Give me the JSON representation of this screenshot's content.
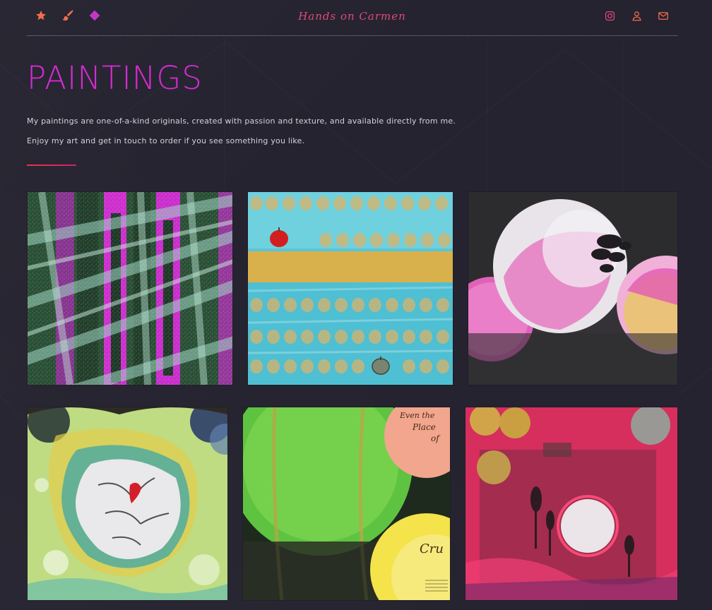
{
  "header": {
    "brand": "Hands on Carmen",
    "left_icons": [
      {
        "name": "star-icon",
        "color": "#f26d4f"
      },
      {
        "name": "paintbrush-icon",
        "color": "#f26d4f"
      },
      {
        "name": "diamond-icon",
        "color": "#c238c6"
      }
    ],
    "right_icons": [
      {
        "name": "instagram-icon",
        "color": "#e0497b"
      },
      {
        "name": "user-icon",
        "color": "#f26d4f"
      },
      {
        "name": "mail-icon",
        "color": "#f26d4f"
      }
    ]
  },
  "main": {
    "title": "PAINTINGS",
    "intro_line_1": "My paintings are one-of-a-kind originals, created with passion and texture, and available directly from me.",
    "intro_line_2": "Enjoy my art and get in touch to order if you see something you like."
  },
  "colors": {
    "background": "#25232f",
    "title": "#d52bd2",
    "accent_red": "#e3383f",
    "accent_pink": "#d31c7a"
  },
  "gallery": {
    "paintings": [
      {
        "id": "painting-1",
        "description_icon": "plaid-abstract"
      },
      {
        "id": "painting-2",
        "description_icon": "turquoise-gold-apples"
      },
      {
        "id": "painting-3",
        "description_icon": "pink-circles"
      },
      {
        "id": "painting-4",
        "description_icon": "shell-heart"
      },
      {
        "id": "painting-5",
        "description_icon": "green-yellow-circles"
      },
      {
        "id": "painting-6",
        "description_icon": "red-moon"
      }
    ],
    "painting_5_text": [
      "Even the",
      "Place",
      "of",
      "Cru"
    ]
  }
}
